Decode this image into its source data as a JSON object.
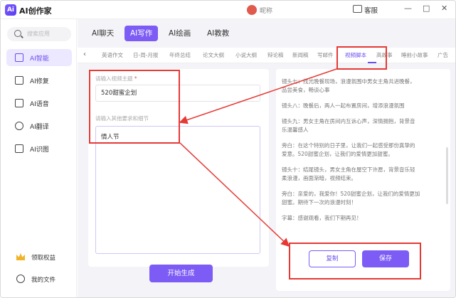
{
  "app": {
    "title": "AI创作家",
    "logo_text": "Ai",
    "nickname": "昵称"
  },
  "window": {
    "support_label": "客服",
    "minimize": "—",
    "maximize": "□",
    "close": "✕"
  },
  "sidebar": {
    "search_placeholder": "搜索应用",
    "items": [
      {
        "label": "AI智能",
        "icon": "ai-smart-icon",
        "active": true
      },
      {
        "label": "AI修复",
        "icon": "edit-icon",
        "active": false
      },
      {
        "label": "AI语音",
        "icon": "voice-icon",
        "active": false
      },
      {
        "label": "AI翻译",
        "icon": "translate-icon",
        "active": false
      },
      {
        "label": "AI识图",
        "icon": "image-icon",
        "active": false
      }
    ],
    "bottom": [
      {
        "label": "领取权益",
        "icon": "crown-icon"
      },
      {
        "label": "我的文件",
        "icon": "file-icon"
      }
    ]
  },
  "tabs": [
    {
      "label": "AI聊天",
      "active": false
    },
    {
      "label": "AI写作",
      "active": true
    },
    {
      "label": "AI绘画",
      "active": false
    },
    {
      "label": "AI教教",
      "active": false
    }
  ],
  "subtabs": [
    {
      "label": "英语作文",
      "active": false
    },
    {
      "label": "日-周-月报",
      "active": false
    },
    {
      "label": "年终总结",
      "active": false
    },
    {
      "label": "论文大纲",
      "active": false
    },
    {
      "label": "小说大纲",
      "active": false
    },
    {
      "label": "辩论稿",
      "active": false
    },
    {
      "label": "新闻稿",
      "active": false
    },
    {
      "label": "写邮件",
      "active": false
    },
    {
      "label": "视频脚本",
      "active": true
    },
    {
      "label": "高故事",
      "active": false
    },
    {
      "label": "睡前小故事",
      "active": false
    },
    {
      "label": "广告",
      "active": false
    }
  ],
  "form": {
    "theme_label": "请输入视频主题",
    "theme_required_mark": "*",
    "theme_value": "520甜蜜企划",
    "requirements_label": "请输入其他要求和细节",
    "requirements_value": "情人节",
    "start_button": "开始生成"
  },
  "output": {
    "lines": [
      "镜头七：找光晚餐现场，浪漫氛围中男女主角共进晚餐，",
      "品尝美食，畅谈心事",
      "镜头八：晚餐后，两人一起布置房间，增添浪漫氛围",
      "镜头九：男女主角在房间内互诉心声，深情拥抱，背景音",
      "乐温馨感人",
      "旁白：在这个特别的日子里，让我们一起感受那份真挚的",
      "爱意。520甜蜜企划，让我们的爱情更加甜蜜。",
      "镜头十：结尾镜头，男女主角在屋空下许愿，背景音乐轻",
      "柔浪漫，画面渐暗，视频结束。",
      "旁白：亲爱的，我爱你！520甜蜜企划，让我们的爱情更加",
      "甜蜜。期待下一次的浪漫时刻！",
      "字幕：感谢观看，我们下期再见！"
    ],
    "copy_button": "复制",
    "save_button": "保存"
  },
  "colors": {
    "accent": "#7c5cf5",
    "highlight": "#e53935"
  }
}
